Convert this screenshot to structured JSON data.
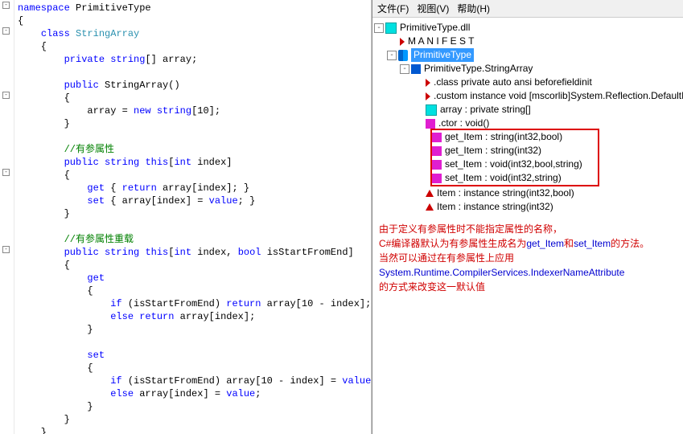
{
  "code": {
    "ns_kw": "namespace",
    "ns_name": "PrimitiveType",
    "class_kw": "class",
    "class_name": "StringArray",
    "private_kw": "private",
    "string_kw": "string",
    "arr_decl": "[] array;",
    "public_kw": "public",
    "ctor_name": "StringArray()",
    "ctor_body": "array = ",
    "new_kw": "new",
    "ctor_body2": "string",
    "ctor_body3": "[10];",
    "cmt1": "//有参属性",
    "idx1_sig_pre": "public",
    "idx1_sig_mid": "string",
    "this_kw": "this",
    "idx1_sig_post": "[",
    "int_kw": "int",
    "idx1_sig_param": " index]",
    "get_kw": "get",
    "get1_body": " { ",
    "return_kw": "return",
    "get1_body2": " array[index]; }",
    "set_kw": "set",
    "set1_body": " { array[index] = ",
    "value_kw": "value",
    "set1_body2": "; }",
    "cmt2": "//有参属性重载",
    "idx2_param": " index, ",
    "bool_kw": "bool",
    "idx2_param2": " isStartFromEnd]",
    "if_kw": "if",
    "if2a": " (isStartFromEnd) ",
    "if2a2": " array[10 - index];",
    "else_kw": "else",
    "else2a": " ",
    "else2a2": " array[index];",
    "if2b": " (isStartFromEnd) array[10 - index] = ",
    "semi": ";",
    "else2b": " array[index] = "
  },
  "menu": {
    "file": "文件(F)",
    "view": "视图(V)",
    "help": "帮助(H)"
  },
  "tree": {
    "root": "PrimitiveType.dll",
    "manifest": "M A N I F E S T",
    "ns": "PrimitiveType",
    "cls": "PrimitiveType.StringArray",
    "m1": ".class private auto ansi beforefieldinit",
    "m2": ".custom instance void [mscorlib]System.Reflection.DefaultM",
    "m3": "array : private string[]",
    "m4": ".ctor : void()",
    "m5": "get_Item : string(int32,bool)",
    "m6": "get_Item : string(int32)",
    "m7": "set_Item : void(int32,bool,string)",
    "m8": "set_Item : void(int32,string)",
    "m9": "Item : instance string(int32,bool)",
    "m10": "Item : instance string(int32)"
  },
  "explain": {
    "l1": "由于定义有参属性时不能指定属性的名称，",
    "l2a": "C#编译器默认为有参属性生成名为",
    "l2b": "get_Item",
    "l2c": "和",
    "l2d": "set_Item",
    "l2e": "的方法。",
    "l3": "当然可以通过在有参属性上应用",
    "l4": "System.Runtime.CompilerServices.IndexerNameAttribute",
    "l5": "的方式来改变这一默认值"
  }
}
